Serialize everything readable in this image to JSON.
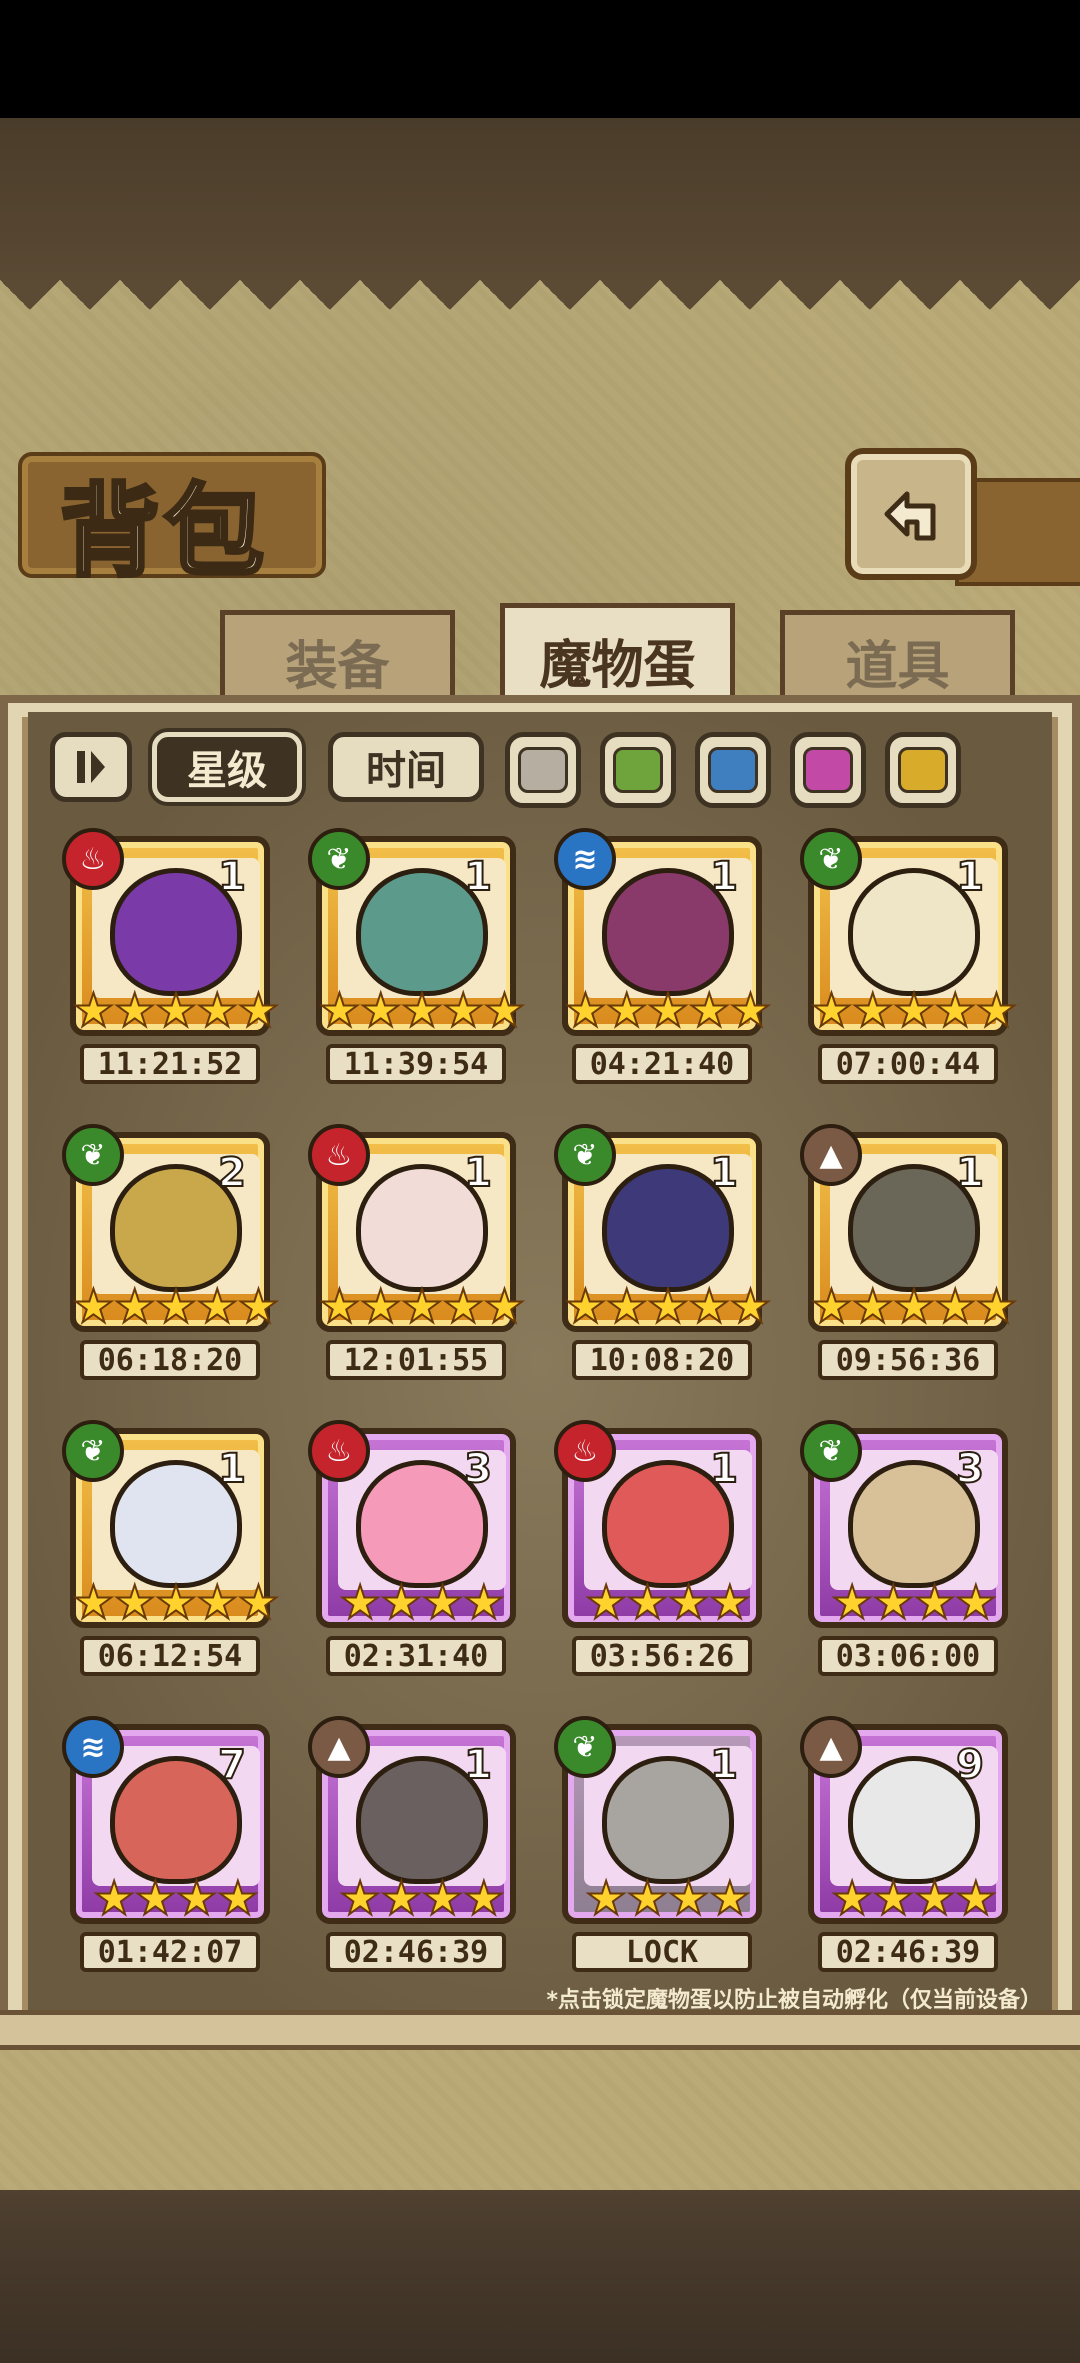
{
  "title": "背包",
  "tabs": [
    {
      "label": "装备",
      "active": false
    },
    {
      "label": "魔物蛋",
      "active": true
    },
    {
      "label": "道具",
      "active": false
    }
  ],
  "filters": {
    "sort_toggle_icon": "sort-toggle-icon",
    "sort_star": "星级",
    "sort_time": "时间",
    "swatches": [
      "#b6aea0",
      "#6fa43c",
      "#3f7fc0",
      "#c249a6",
      "#d9ab2a"
    ]
  },
  "eggs": [
    {
      "element": "fire",
      "count": "1",
      "stars": 5,
      "rarity": "gold",
      "timer": "11:21:52",
      "color": "#7a3aa8"
    },
    {
      "element": "grass",
      "count": "1",
      "stars": 5,
      "rarity": "gold",
      "timer": "11:39:54",
      "color": "#5c9a8c"
    },
    {
      "element": "water",
      "count": "1",
      "stars": 5,
      "rarity": "gold",
      "timer": "04:21:40",
      "color": "#8a3a6a"
    },
    {
      "element": "grass",
      "count": "1",
      "stars": 5,
      "rarity": "gold",
      "timer": "07:00:44",
      "color": "#efe6c8"
    },
    {
      "element": "grass",
      "count": "2",
      "stars": 5,
      "rarity": "gold",
      "timer": "06:18:20",
      "color": "#c8a84a"
    },
    {
      "element": "fire",
      "count": "1",
      "stars": 5,
      "rarity": "gold",
      "timer": "12:01:55",
      "color": "#f1dcd8"
    },
    {
      "element": "grass",
      "count": "1",
      "stars": 5,
      "rarity": "gold",
      "timer": "10:08:20",
      "color": "#3e3a7a"
    },
    {
      "element": "earth",
      "count": "1",
      "stars": 5,
      "rarity": "gold",
      "timer": "09:56:36",
      "color": "#6a6658"
    },
    {
      "element": "grass",
      "count": "1",
      "stars": 5,
      "rarity": "gold",
      "timer": "06:12:54",
      "color": "#dfe4f0"
    },
    {
      "element": "fire",
      "count": "3",
      "stars": 4,
      "rarity": "purple",
      "timer": "02:31:40",
      "color": "#f59ab8"
    },
    {
      "element": "fire",
      "count": "1",
      "stars": 4,
      "rarity": "purple",
      "timer": "03:56:26",
      "color": "#e05a5a"
    },
    {
      "element": "grass",
      "count": "3",
      "stars": 4,
      "rarity": "purple",
      "timer": "03:06:00",
      "color": "#d8c098"
    },
    {
      "element": "water",
      "count": "7",
      "stars": 4,
      "rarity": "purple",
      "timer": "01:42:07",
      "color": "#d8655a"
    },
    {
      "element": "earth",
      "count": "1",
      "stars": 4,
      "rarity": "purple",
      "timer": "02:46:39",
      "color": "#6a6060"
    },
    {
      "element": "grass",
      "count": "1",
      "stars": 4,
      "rarity": "purple",
      "timer": "LOCK",
      "color": "#a8a4a0",
      "locked": true
    },
    {
      "element": "earth",
      "count": "9",
      "stars": 4,
      "rarity": "purple",
      "timer": "02:46:39",
      "color": "#e8e8e8"
    }
  ],
  "note": "*点击锁定魔物蛋以防止被自动孵化（仅当前设备）"
}
